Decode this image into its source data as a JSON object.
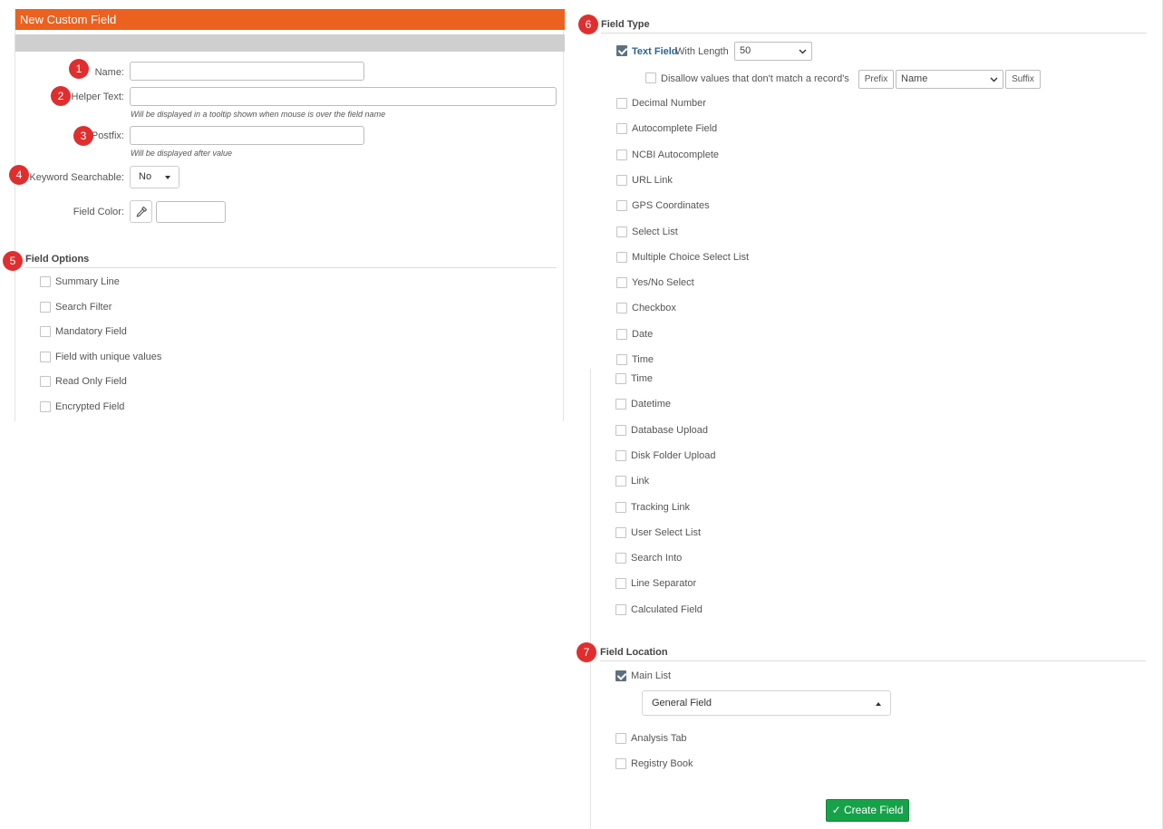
{
  "left_panel": {
    "title": "New Custom Field",
    "name_label": "Name:",
    "helper_label": "Helper Text:",
    "helper_hint": "Will be displayed in a tooltip shown when mouse is over the field name",
    "postfix_label": "Postfix:",
    "postfix_hint": "Will be displayed after value",
    "keyword_label": "Keyword Searchable:",
    "keyword_value": "No",
    "color_label": "Field Color:",
    "field_options_title": "Field Options",
    "options": [
      {
        "label": "Summary Line",
        "checked": false
      },
      {
        "label": "Search Filter",
        "checked": false
      },
      {
        "label": "Mandatory Field",
        "checked": false
      },
      {
        "label": "Field with unique values",
        "checked": false
      },
      {
        "label": "Read Only Field",
        "checked": false
      },
      {
        "label": "Encrypted Field",
        "checked": false
      }
    ]
  },
  "field_type": {
    "title": "Field Type",
    "text_field_label": "Text Field",
    "with_length_label": "With Length",
    "length_value": "50",
    "disallow_label": "Disallow values that don't match a record's",
    "prefix_label": "Prefix",
    "name_select_value": "Name",
    "suffix_label": "Suffix",
    "types_top": [
      "Decimal Number",
      "Autocomplete Field",
      "NCBI Autocomplete",
      "URL Link",
      "GPS Coordinates",
      "Select List",
      "Multiple Choice Select List",
      "Yes/No Select",
      "Checkbox",
      "Date",
      "Time"
    ],
    "types_bottom": [
      "Time",
      "Datetime",
      "Database Upload",
      "Disk Folder Upload",
      "Link",
      "Tracking Link",
      "User Select List",
      "Search Into",
      "Line Separator",
      "Calculated Field"
    ]
  },
  "field_location": {
    "title": "Field Location",
    "main_list_label": "Main List",
    "location_value": "General Field",
    "analysis_tab_label": "Analysis Tab",
    "registry_book_label": "Registry Book"
  },
  "create_button_label": "Create Field",
  "markers": [
    "1",
    "2",
    "3",
    "4",
    "5",
    "6",
    "7"
  ],
  "colors": {
    "header_orange": "#ec6120",
    "marker_red": "#e02e2e",
    "checked_box": "#5d7080",
    "link_blue": "#2a6496",
    "create_green": "#17a24a"
  }
}
